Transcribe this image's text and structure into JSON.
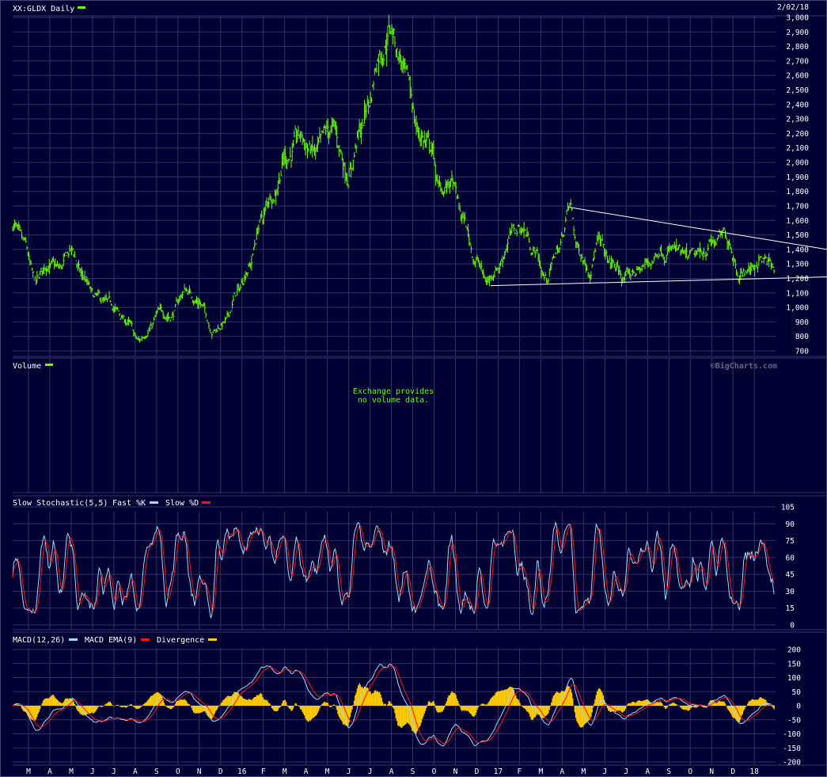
{
  "header": {
    "title": "XX:GLDX Daily",
    "date": "2/02/18"
  },
  "volume": {
    "title": "Volume",
    "message_line1": "Exchange provides",
    "message_line2": "no volume data.",
    "copyright": "©BigCharts.com"
  },
  "stochastic": {
    "title": "Slow Stochastic(5,5)",
    "fast_label": "Fast %K",
    "slow_label": "Slow %D",
    "ticks": [
      "105",
      "90",
      "75",
      "60",
      "45",
      "30",
      "15",
      "0"
    ]
  },
  "macd": {
    "title": "MACD(12,26)",
    "ema_label": "MACD EMA(9)",
    "div_label": "Divergence",
    "ticks": [
      "200",
      "150",
      "100",
      "50",
      "0",
      "-50",
      "-100",
      "-150",
      "-200"
    ]
  },
  "colors": {
    "background": "#000033",
    "grid": "#33336a",
    "price": "#66ff00",
    "fast_k": "#99ddff",
    "slow_d": "#ff1010",
    "divergence": "#ffcc00",
    "trendline": "#ffffff"
  },
  "chart_data": {
    "type": "line",
    "title": "XX:GLDX Daily",
    "price_axis": {
      "min": 700,
      "max": 3000,
      "step": 100,
      "ticks": [
        "3,000",
        "2,900",
        "2,800",
        "2,700",
        "2,600",
        "2,500",
        "2,400",
        "2,300",
        "2,200",
        "2,100",
        "2,000",
        "1,900",
        "1,800",
        "1,700",
        "1,600",
        "1,500",
        "1,400",
        "1,300",
        "1,200",
        "1,100",
        "1,000",
        "900",
        "800",
        "700"
      ]
    },
    "x_tick_labels": [
      "M",
      "A",
      "M",
      "J",
      "J",
      "A",
      "S",
      "O",
      "N",
      "D",
      "16",
      "F",
      "M",
      "A",
      "M",
      "J",
      "J",
      "A",
      "S",
      "O",
      "N",
      "D",
      "17",
      "F",
      "M",
      "A",
      "M",
      "J",
      "J",
      "A",
      "S",
      "O",
      "N",
      "D",
      "18"
    ],
    "span_months": 35.7,
    "price_keypoints": {
      "t_months": [
        0,
        0.52,
        1.07,
        1.63,
        2.19,
        2.74,
        3.3,
        3.85,
        4.59,
        5.33,
        5.89,
        6.44,
        6.81,
        7.37,
        8.11,
        8.67,
        9.41,
        9.96,
        10.52,
        11.07,
        11.63,
        12.19,
        12.74,
        13.48,
        14.22,
        14.96,
        15.7,
        16.26,
        16.63,
        17.19,
        17.67,
        18.11,
        18.48,
        19.04,
        19.59,
        19.96,
        20.52,
        21.07,
        21.63,
        22.19,
        22.74,
        23.3,
        23.85,
        24.41,
        24.96,
        25.52,
        26.07,
        26.44,
        27,
        27.37,
        27.93,
        28.67,
        29.22,
        29.78,
        30.33,
        30.89,
        31.44,
        32,
        32.74,
        33.48,
        34.04,
        34.59,
        34.96,
        35.33,
        35.63
      ],
      "close": [
        1580,
        1400,
        1150,
        1300,
        1250,
        1380,
        1200,
        1050,
        1000,
        900,
        760,
        870,
        950,
        950,
        1120,
        1050,
        850,
        900,
        1100,
        1300,
        1600,
        1800,
        2050,
        2150,
        2050,
        2200,
        1950,
        2200,
        2400,
        2800,
        2950,
        2750,
        2500,
        2200,
        2100,
        1800,
        1850,
        1600,
        1350,
        1180,
        1300,
        1500,
        1550,
        1400,
        1200,
        1400,
        1680,
        1400,
        1300,
        1450,
        1300,
        1200,
        1250,
        1300,
        1420,
        1400,
        1320,
        1330,
        1450,
        1480,
        1250,
        1270,
        1340,
        1300,
        1240
      ]
    },
    "trendlines": [
      {
        "name": "resistance",
        "from": {
          "t_months": 26.07,
          "price": 1690
        },
        "to": {
          "t_months": 38.1,
          "price": 1400
        }
      },
      {
        "name": "support",
        "from": {
          "t_months": 22.37,
          "price": 1150
        },
        "to": {
          "t_months": 38.1,
          "price": 1210
        }
      }
    ],
    "stochastic_range": [
      0,
      105
    ],
    "macd_range": [
      -200,
      200
    ]
  }
}
